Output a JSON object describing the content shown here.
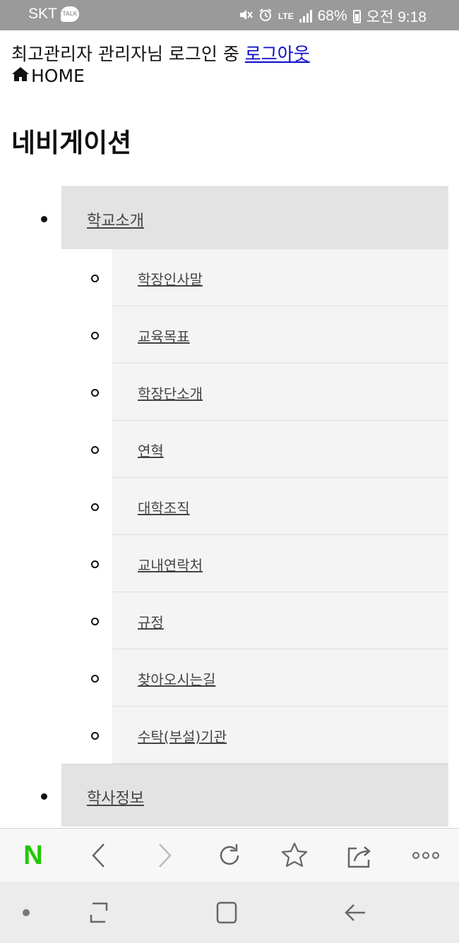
{
  "status_bar": {
    "carrier": "SKT",
    "talk_badge": "TALK",
    "battery": "68%",
    "time": "오전 9:18",
    "network": "LTE",
    "icons": [
      "mute-icon",
      "alarm-icon",
      "signal-icon",
      "battery-icon"
    ]
  },
  "header": {
    "login_text": "최고관리자 관리자님 로그인 중",
    "logout_link": "로그아웃",
    "home_label": "HOME"
  },
  "navigation": {
    "title": "네비게이션",
    "menu": [
      {
        "label": "학교소개",
        "children": [
          {
            "label": "학장인사말"
          },
          {
            "label": "교육목표"
          },
          {
            "label": "학장단소개"
          },
          {
            "label": "연혁"
          },
          {
            "label": "대학조직"
          },
          {
            "label": "교내연락처"
          },
          {
            "label": "규정"
          },
          {
            "label": "찾아오시는길"
          },
          {
            "label": "수탁(부설)기관"
          }
        ]
      },
      {
        "label": "학사정보",
        "children": []
      }
    ]
  },
  "browser_toolbar": {
    "logo": "N",
    "buttons": [
      "back-icon",
      "forward-icon",
      "reload-icon",
      "bookmark-star-icon",
      "share-icon",
      "more-icon"
    ]
  },
  "system_nav": {
    "buttons": [
      "recent-apps-icon",
      "home-icon",
      "back-arrow-icon"
    ]
  },
  "colors": {
    "status_bar_bg": "#9a9a9a",
    "link": "#0b0bcc",
    "top_menu_bg": "#e3e3e3",
    "sub_menu_bg": "#f4f4f4",
    "naver_green": "#1ec800"
  }
}
